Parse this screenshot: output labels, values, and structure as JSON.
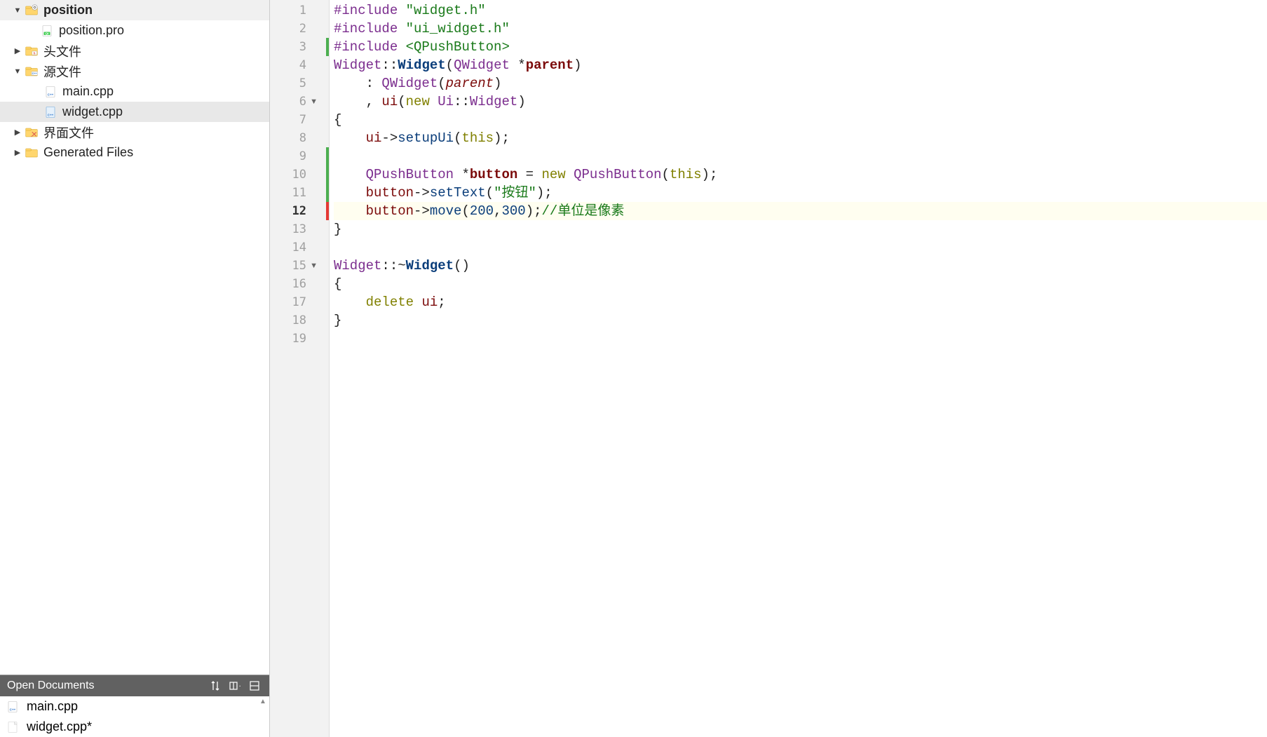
{
  "project": {
    "root": "position",
    "items": [
      {
        "label": "position.pro",
        "kind": "pro"
      },
      {
        "label": "头文件",
        "kind": "folder-h",
        "expandable": true
      },
      {
        "label": "源文件",
        "kind": "folder-cpp",
        "expandable": true,
        "expanded": true,
        "children": [
          {
            "label": "main.cpp",
            "kind": "cpp"
          },
          {
            "label": "widget.cpp",
            "kind": "cpp",
            "selected": true
          }
        ]
      },
      {
        "label": "界面文件",
        "kind": "folder-ui",
        "expandable": true
      },
      {
        "label": "Generated Files",
        "kind": "folder-plain",
        "expandable": true
      }
    ]
  },
  "open_docs": {
    "title": "Open Documents",
    "items": [
      {
        "label": "main.cpp",
        "kind": "cpp"
      },
      {
        "label": "widget.cpp*",
        "kind": "file"
      }
    ]
  },
  "editor": {
    "current_line": 12,
    "lines": [
      {
        "n": 1,
        "html": "<span class='tok-pp'>#include</span> <span class='tok-str'>\"widget.h\"</span>"
      },
      {
        "n": 2,
        "html": "<span class='tok-pp'>#include</span> <span class='tok-str'>\"ui_widget.h\"</span>"
      },
      {
        "n": 3,
        "bar": "green",
        "html": "<span class='tok-pp'>#include</span> <span class='tok-str'>&lt;QPushButton&gt;</span>"
      },
      {
        "n": 4,
        "html": "<span class='tok-type'>Widget</span><span class='tok-punct'>::</span><span class='tok-func'>Widget</span><span class='tok-punct'>(</span><span class='tok-type'>QWidget</span> <span class='tok-punct'>*</span><span class='tok-param-bold'>parent</span><span class='tok-punct'>)</span>"
      },
      {
        "n": 5,
        "scope": 1,
        "html": "    <span class='tok-punct'>:</span> <span class='tok-type'>QWidget</span><span class='tok-punct'>(</span><span class='tok-param'>parent</span><span class='tok-punct'>)</span>"
      },
      {
        "n": 6,
        "fold": true,
        "scope": 1,
        "html": "    <span class='tok-punct'>,</span> <span class='tok-ident'>ui</span><span class='tok-punct'>(</span><span class='tok-kw'>new</span> <span class='tok-type'>Ui</span><span class='tok-punct'>::</span><span class='tok-type'>Widget</span><span class='tok-punct'>)</span>"
      },
      {
        "n": 7,
        "html": "<span class='tok-punct'>{</span>"
      },
      {
        "n": 8,
        "scope": 1,
        "html": "    <span class='tok-ident'>ui</span><span class='tok-punct'>-&gt;</span><span class='tok-method'>setupUi</span><span class='tok-punct'>(</span><span class='tok-kw'>this</span><span class='tok-punct'>);</span>"
      },
      {
        "n": 9,
        "bar": "green",
        "scope": 1,
        "html": ""
      },
      {
        "n": 10,
        "bar": "green",
        "scope": 1,
        "html": "    <span class='tok-type'>QPushButton</span> <span class='tok-punct'>*</span><span class='tok-var'>button</span> <span class='tok-punct'>=</span> <span class='tok-kw'>new</span> <span class='tok-type'>QPushButton</span><span class='tok-punct'>(</span><span class='tok-kw'>this</span><span class='tok-punct'>);</span>"
      },
      {
        "n": 11,
        "bar": "green",
        "scope": 1,
        "html": "    <span class='tok-ident'>button</span><span class='tok-punct'>-&gt;</span><span class='tok-method'>setText</span><span class='tok-punct'>(</span><span class='tok-str'>\"按钮\"</span><span class='tok-punct'>);</span>"
      },
      {
        "n": 12,
        "bar": "red",
        "scope": 1,
        "current": true,
        "html": "    <span class='tok-ident'>button</span><span class='tok-punct'>-&gt;</span><span class='tok-method'>move</span><span class='tok-punct'>(</span><span class='tok-num'>200</span><span class='tok-punct'>,</span><span class='tok-num'>300</span><span class='tok-punct'>);</span><span class='tok-comment'>//单位是像素</span>"
      },
      {
        "n": 13,
        "html": "<span class='tok-punct'>}</span>"
      },
      {
        "n": 14,
        "html": ""
      },
      {
        "n": 15,
        "fold": true,
        "html": "<span class='tok-type'>Widget</span><span class='tok-punct'>::~</span><span class='tok-func'>Widget</span><span class='tok-punct'>()</span>"
      },
      {
        "n": 16,
        "html": "<span class='tok-punct'>{</span>"
      },
      {
        "n": 17,
        "scope": 1,
        "html": "    <span class='tok-kw'>delete</span> <span class='tok-ident'>ui</span><span class='tok-punct'>;</span>"
      },
      {
        "n": 18,
        "html": "<span class='tok-punct'>}</span>"
      },
      {
        "n": 19,
        "html": ""
      }
    ]
  }
}
